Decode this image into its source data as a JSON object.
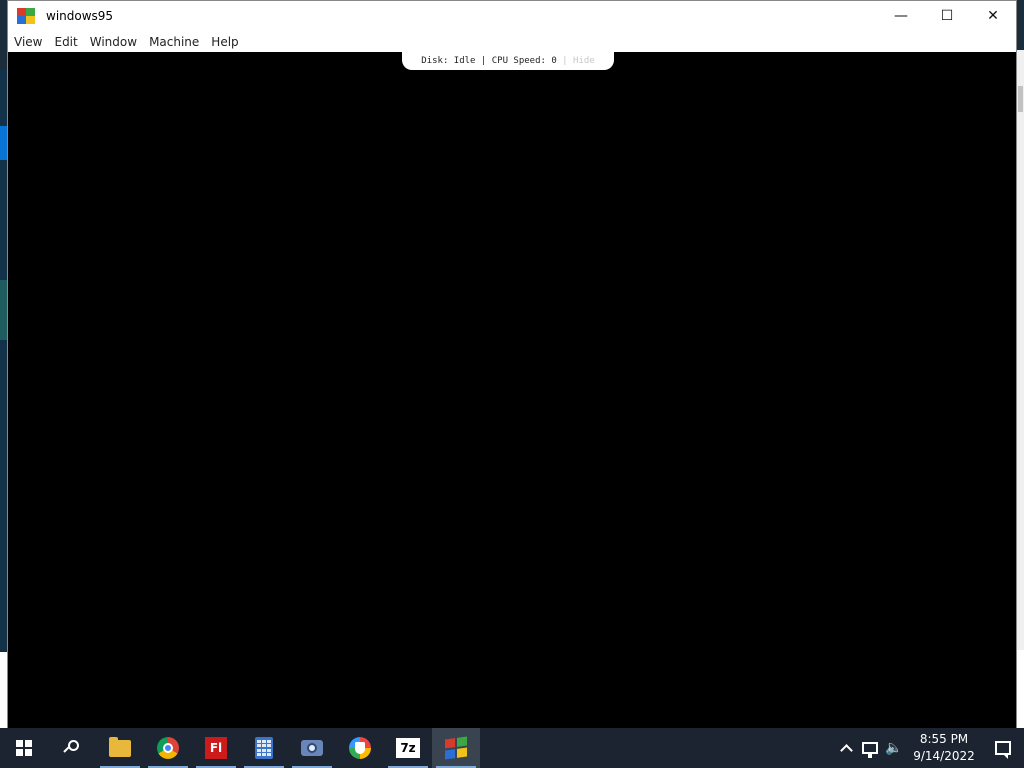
{
  "window": {
    "title": "windows95",
    "controls": {
      "minimize": "—",
      "maximize": "☐",
      "close": "✕"
    }
  },
  "menubar": {
    "items": [
      "View",
      "Edit",
      "Window",
      "Machine",
      "Help"
    ]
  },
  "status": {
    "disk_label": "Disk: Idle",
    "separator": " | ",
    "cpu_label": "CPU Speed: 0",
    "hide_label": "Hide"
  },
  "taskbar": {
    "apps": [
      {
        "name": "start",
        "icon": "windows-start-icon"
      },
      {
        "name": "search",
        "icon": "search-icon"
      },
      {
        "name": "file-explorer",
        "icon": "folder-icon"
      },
      {
        "name": "chrome",
        "icon": "chrome-icon"
      },
      {
        "name": "flash",
        "icon": "flash-icon",
        "text": "Fl"
      },
      {
        "name": "calculator",
        "icon": "calculator-icon"
      },
      {
        "name": "camera",
        "icon": "camera-icon"
      },
      {
        "name": "vpn",
        "icon": "shield-icon"
      },
      {
        "name": "7zip",
        "icon": "7zip-icon",
        "text": "7z"
      },
      {
        "name": "windows95",
        "icon": "windows95-icon"
      }
    ],
    "tray": {
      "time": "8:55 PM",
      "date": "9/14/2022"
    }
  },
  "colors": {
    "taskbar_bg": "#1b2430",
    "screen_bg": "#000000",
    "titlebar_bg": "#ffffff",
    "accent": "#7fa9d8"
  }
}
